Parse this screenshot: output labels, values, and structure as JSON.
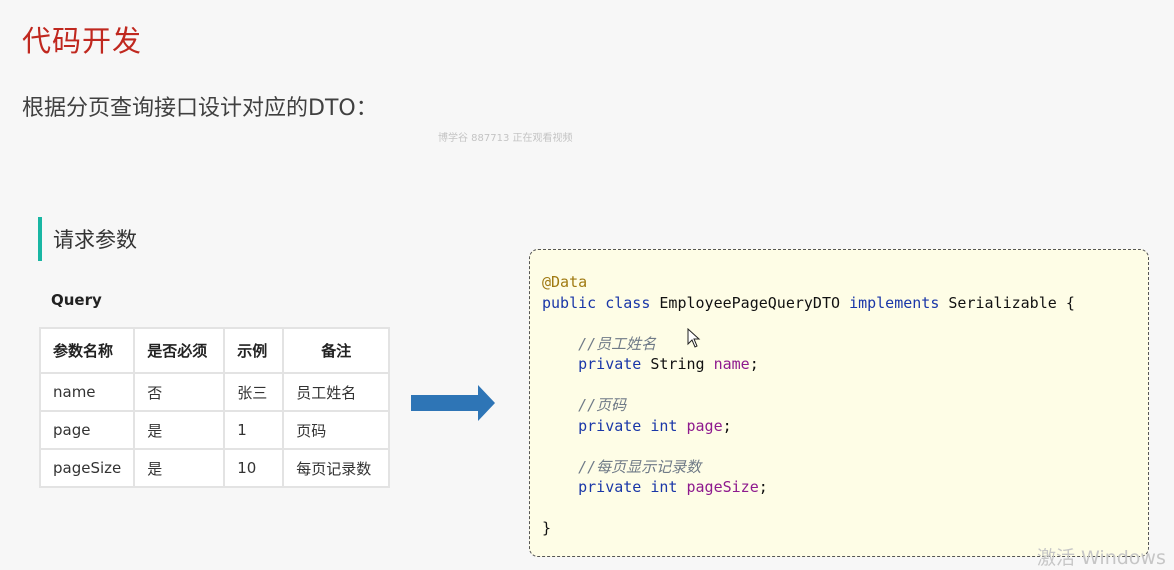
{
  "title": "代码开发",
  "subtitle": "根据分页查询接口设计对应的DTO：",
  "watermark": "博学谷 887713 正在观看视频",
  "section_title": "请求参数",
  "query_label": "Query",
  "table": {
    "headers": [
      "参数名称",
      "是否必须",
      "示例",
      "备注"
    ],
    "rows": [
      [
        "name",
        "否",
        "张三",
        "员工姓名"
      ],
      [
        "page",
        "是",
        "1",
        "页码"
      ],
      [
        "pageSize",
        "是",
        "10",
        "每页记录数"
      ]
    ]
  },
  "code": {
    "annotation": "@Data",
    "decl_public": "public",
    "decl_class": "class",
    "class_name": "EmployeePageQueryDTO",
    "decl_implements": "implements",
    "interface_name": "Serializable",
    "open_brace": "{",
    "fields": [
      {
        "comment": "//员工姓名",
        "modifier": "private",
        "type": "String",
        "name": "name",
        "type_is_keyword": false
      },
      {
        "comment": "//页码",
        "modifier": "private",
        "type": "int",
        "name": "page",
        "type_is_keyword": true
      },
      {
        "comment": "//每页显示记录数",
        "modifier": "private",
        "type": "int",
        "name": "pageSize",
        "type_is_keyword": true
      }
    ],
    "semicolon": ";",
    "close_brace": "}"
  },
  "os_watermark": "激活 Windows",
  "colors": {
    "title": "#c0281f",
    "section_bar": "#19b6a3",
    "arrow": "#2e75b6",
    "code_bg": "#fefde6",
    "keyword": "#1a37a8",
    "field": "#8e1a8e",
    "annotation": "#a07a12",
    "comment": "#6f7a87"
  },
  "icons": [
    "right-arrow-icon",
    "mouse-cursor-icon"
  ]
}
